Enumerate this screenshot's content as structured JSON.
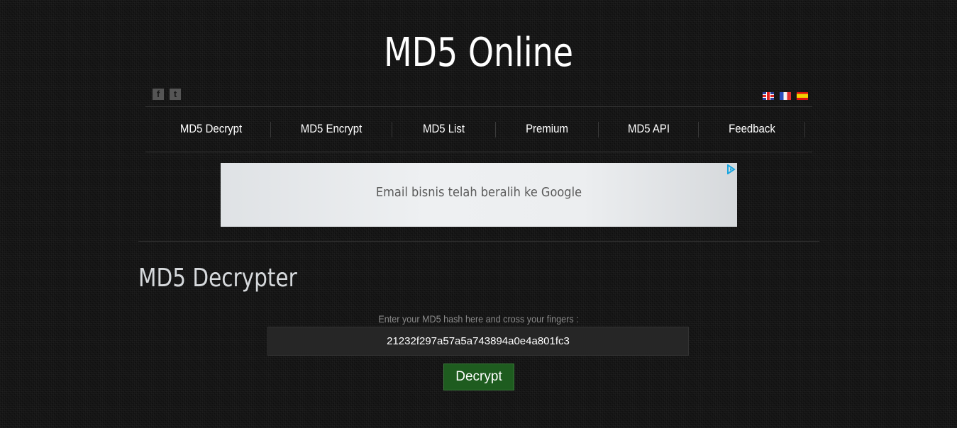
{
  "header": {
    "title": "MD5 Online"
  },
  "social": [
    {
      "name": "facebook",
      "glyph": "f"
    },
    {
      "name": "twitter",
      "glyph": "t"
    }
  ],
  "languages": [
    {
      "code": "en",
      "icon": "uk-flag-icon"
    },
    {
      "code": "fr",
      "icon": "france-flag-icon"
    },
    {
      "code": "es",
      "icon": "spain-flag-icon"
    }
  ],
  "nav": {
    "items": [
      {
        "label": "MD5 Decrypt"
      },
      {
        "label": "MD5 Encrypt"
      },
      {
        "label": "MD5 List"
      },
      {
        "label": "Premium"
      },
      {
        "label": "MD5 API"
      },
      {
        "label": "Feedback"
      }
    ]
  },
  "ad": {
    "text": "Email bisnis telah beralih ke Google"
  },
  "main": {
    "section_title": "MD5 Decrypter",
    "hint": "Enter your MD5 hash here and cross your fingers :",
    "hash_value": "21232f297a57a5a743894a0e4a801fc3",
    "decrypt_label": "Decrypt"
  },
  "colors": {
    "background": "#141414",
    "button": "#1e5c1f",
    "input_bg": "#262626"
  }
}
